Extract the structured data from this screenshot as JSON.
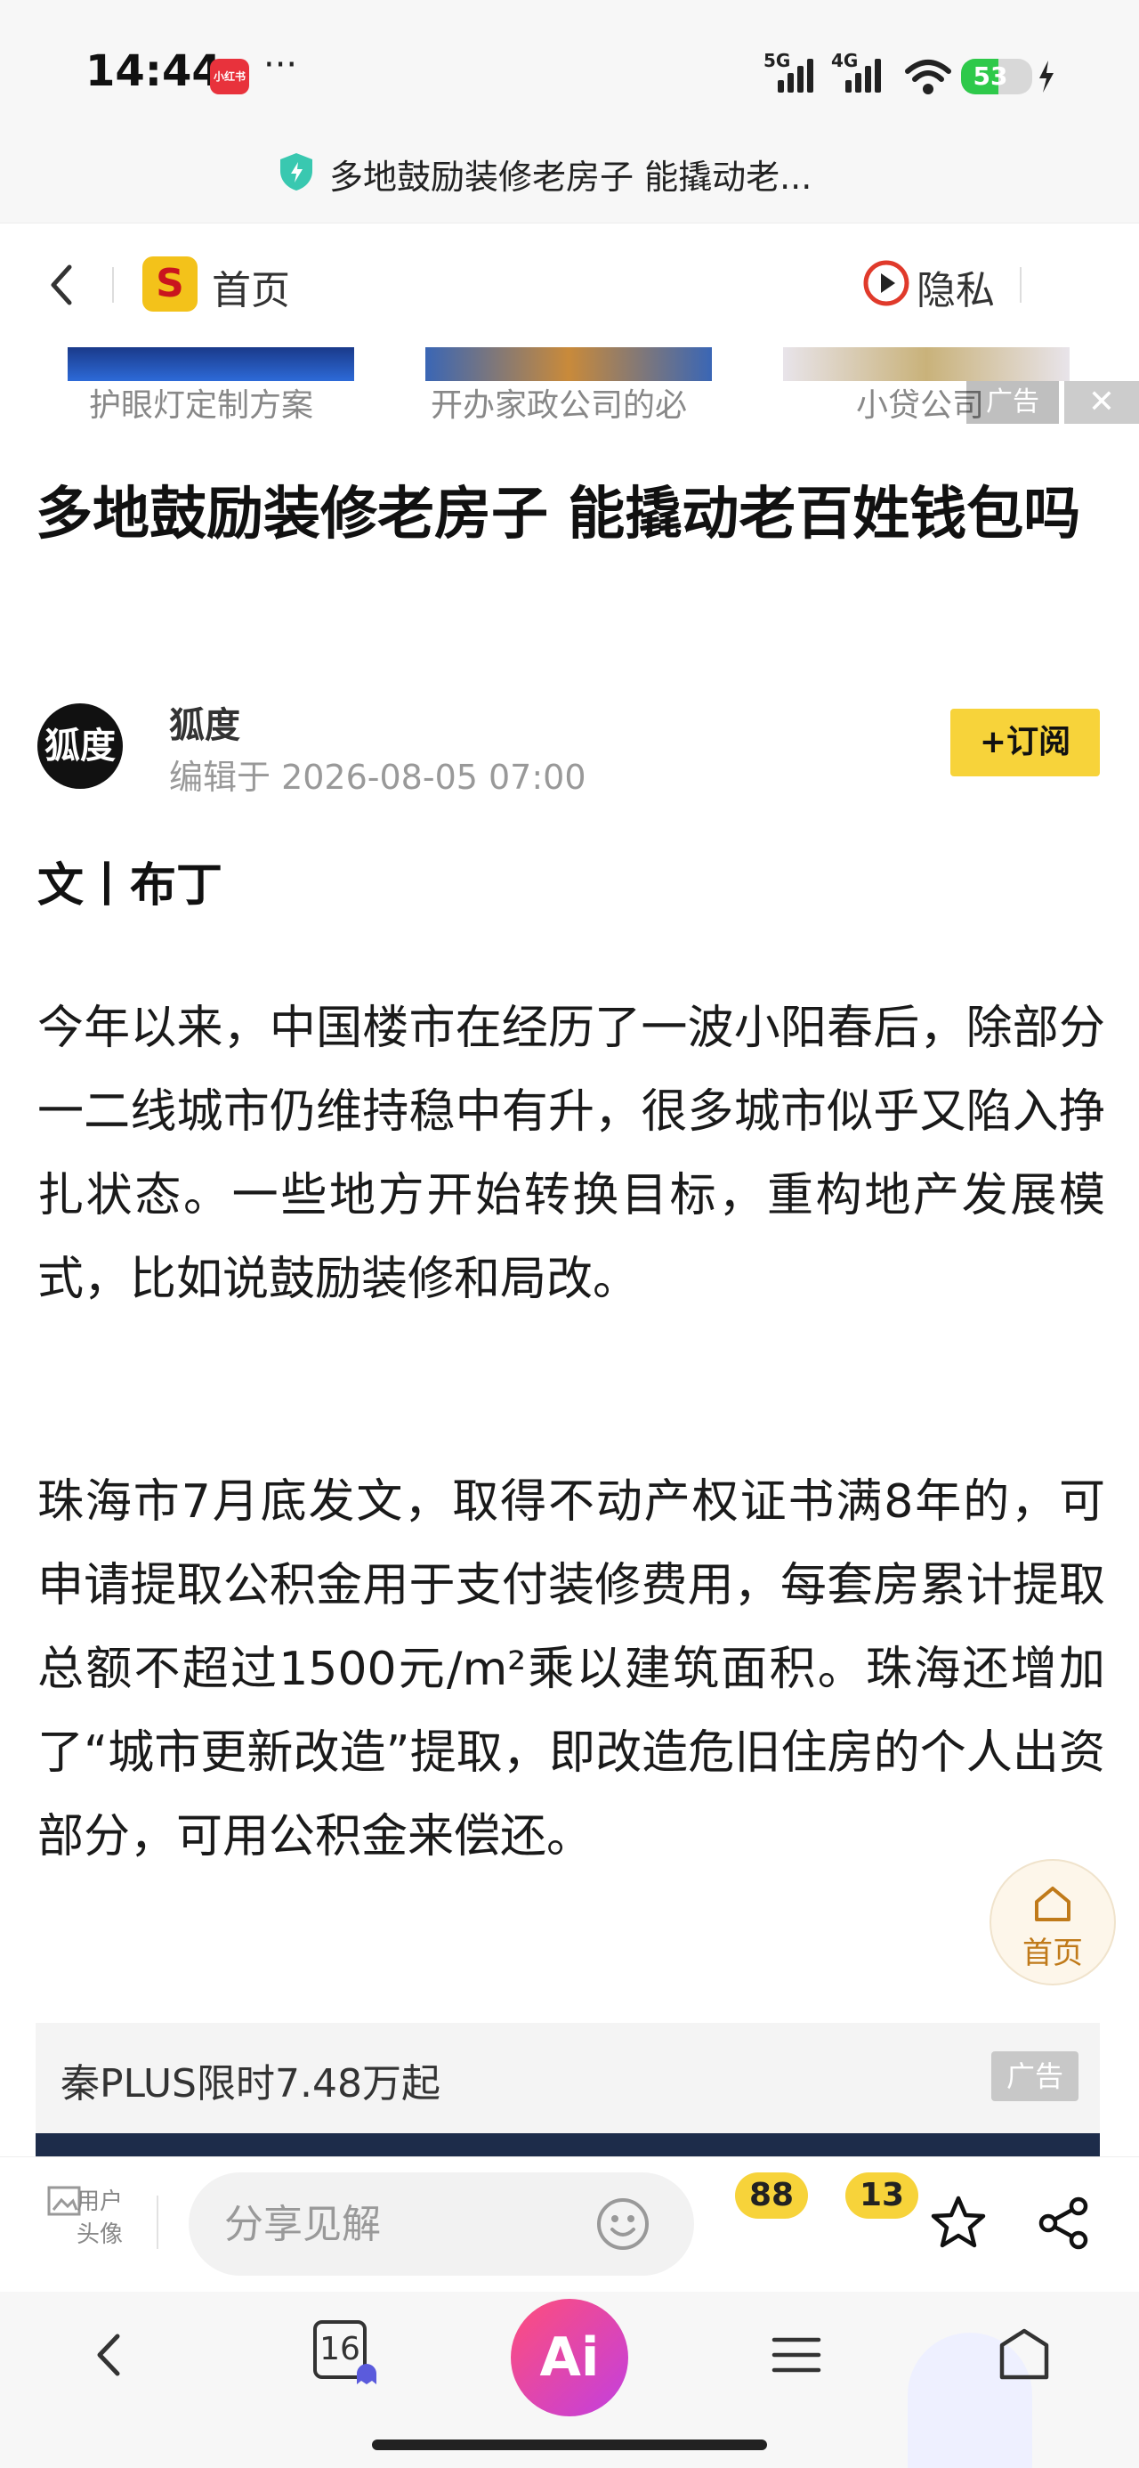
{
  "status_bar": {
    "time": "14:44",
    "app_badge": "小红书",
    "more": "···",
    "net1": "5G",
    "net2": "4G",
    "battery_level": 53,
    "battery_text": "53"
  },
  "title_bar": {
    "title": "多地鼓励装修老房子 能撬动老..."
  },
  "nav": {
    "logo_text": "S",
    "home_label": "首页",
    "privacy_label": "隐私"
  },
  "ad_strip": {
    "captions": [
      "护眼灯定制方案",
      "开办家政公司的必",
      "小贷公司"
    ],
    "ad_label": "广告",
    "close": "✕"
  },
  "article": {
    "headline": "多地鼓励装修老房子 能撬动老百姓钱包吗",
    "author": "狐度",
    "avatar_text": "狐度",
    "edited": "编辑于 2026-08-05 07:00",
    "subscribe": "+订阅",
    "byline": "文丨布丁",
    "paragraphs": [
      "今年以来，中国楼市在经历了一波小阳春后，除部分一二线城市仍维持稳中有升，很多城市似乎又陷入挣扎状态。一些地方开始转换目标，重构地产发展模式，比如说鼓励装修和局改。",
      "珠海市7月底发文，取得不动产权证书满8年的，可申请提取公积金用于支付装修费用，每套房累计提取总额不超过1500元/m²乘以建筑面积。珠海还增加了“城市更新改造”提取，即改造危旧住房的个人出资部分，可用公积金来偿还。"
    ]
  },
  "float_home": {
    "label": "首页"
  },
  "ad_block": {
    "text": "秦PLUS限时7.48万起",
    "tag": "广告"
  },
  "comment_bar": {
    "image_alt": "用户头像",
    "placeholder": "分享见解",
    "comment_count": "88",
    "like_count": "13"
  },
  "browser_bar": {
    "tab_count": "16",
    "ai_label": "Ai"
  }
}
